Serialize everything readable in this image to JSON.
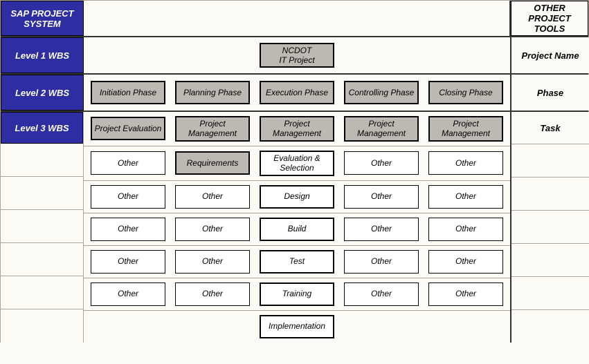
{
  "headers": {
    "left": "SAP PROJECT SYSTEM",
    "right": "OTHER PROJECT TOOLS"
  },
  "levels": {
    "l1": {
      "label": "Level 1 WBS",
      "right": "Project Name"
    },
    "l2": {
      "label": "Level 2 WBS",
      "right": "Phase"
    },
    "l3": {
      "label": "Level 3 WBS",
      "right": "Task"
    }
  },
  "l1_box": "NCDOT\nIT Project",
  "phases": {
    "c1": "Initiation Phase",
    "c2": "Planning Phase",
    "c3": "Execution Phase",
    "c4": "Controlling Phase",
    "c5": "Closing Phase"
  },
  "tasks": {
    "r1": {
      "c1": "Project Evaluation",
      "c2": "Project Management",
      "c3": "Project Management",
      "c4": "Project Management",
      "c5": "Project Management"
    },
    "r2": {
      "c1": "Other",
      "c2": "Requirements",
      "c3": "Evaluation & Selection",
      "c4": "Other",
      "c5": "Other"
    },
    "r3": {
      "c1": "Other",
      "c2": "Other",
      "c3": "Design",
      "c4": "Other",
      "c5": "Other"
    },
    "r4": {
      "c1": "Other",
      "c2": "Other",
      "c3": "Build",
      "c4": "Other",
      "c5": "Other"
    },
    "r5": {
      "c1": "Other",
      "c2": "Other",
      "c3": "Test",
      "c4": "Other",
      "c5": "Other"
    },
    "r6": {
      "c1": "Other",
      "c2": "Other",
      "c3": "Training",
      "c4": "Other",
      "c5": "Other"
    },
    "r7": {
      "c3": "Implementation"
    }
  },
  "chart_data": {
    "type": "table",
    "title": "WBS Structure Mapping: SAP Project System vs Other Project Tools",
    "columns": [
      "Initiation Phase",
      "Planning Phase",
      "Execution Phase",
      "Controlling Phase",
      "Closing Phase"
    ],
    "levels": [
      {
        "level": "Level 1 WBS",
        "other_tools_label": "Project Name",
        "center_value": "NCDOT IT Project"
      },
      {
        "level": "Level 2 WBS",
        "other_tools_label": "Phase",
        "row": [
          "Initiation Phase",
          "Planning Phase",
          "Execution Phase",
          "Controlling Phase",
          "Closing Phase"
        ]
      },
      {
        "level": "Level 3 WBS",
        "other_tools_label": "Task",
        "rows": [
          [
            "Project Evaluation",
            "Project Management",
            "Project Management",
            "Project Management",
            "Project Management"
          ],
          [
            "Other",
            "Requirements",
            "Evaluation & Selection",
            "Other",
            "Other"
          ],
          [
            "Other",
            "Other",
            "Design",
            "Other",
            "Other"
          ],
          [
            "Other",
            "Other",
            "Build",
            "Other",
            "Other"
          ],
          [
            "Other",
            "Other",
            "Test",
            "Other",
            "Other"
          ],
          [
            "Other",
            "Other",
            "Training",
            "Other",
            "Other"
          ],
          [
            null,
            null,
            "Implementation",
            null,
            null
          ]
        ]
      }
    ]
  }
}
